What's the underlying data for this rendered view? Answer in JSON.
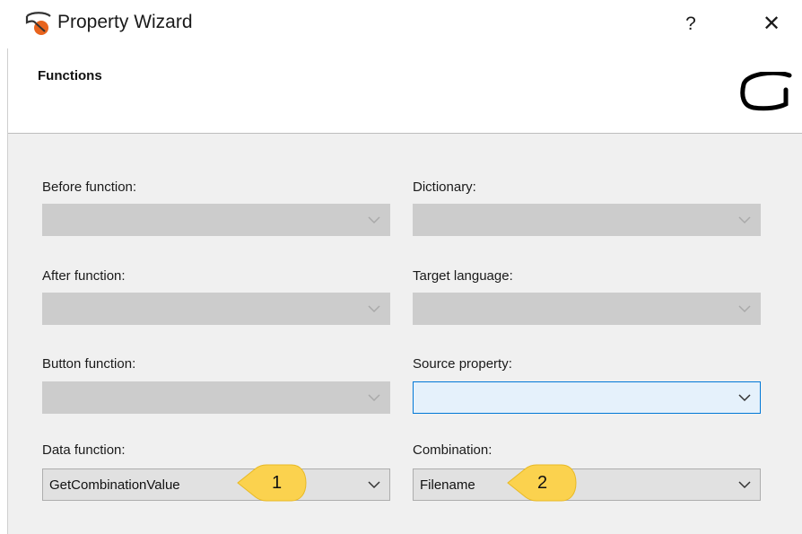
{
  "window": {
    "title": "Property Wizard",
    "help_label": "?",
    "close_label": "✕"
  },
  "header": {
    "title": "Functions"
  },
  "fields": {
    "before_function": {
      "label": "Before function:",
      "value": ""
    },
    "dictionary": {
      "label": "Dictionary:",
      "value": ""
    },
    "after_function": {
      "label": "After function:",
      "value": ""
    },
    "target_language": {
      "label": "Target language:",
      "value": ""
    },
    "button_function": {
      "label": "Button function:",
      "value": ""
    },
    "source_property": {
      "label": "Source property:",
      "value": ""
    },
    "data_function": {
      "label": "Data function:",
      "value": "GetCombinationValue"
    },
    "combination": {
      "label": "Combination:",
      "value": "Filename"
    }
  },
  "callouts": {
    "first": "1",
    "second": "2"
  },
  "colors": {
    "disabled_combo": "#cccccc",
    "active_border": "#0078d7",
    "callout_fill": "#fbd24e",
    "content_bg": "#f0f0f0"
  }
}
